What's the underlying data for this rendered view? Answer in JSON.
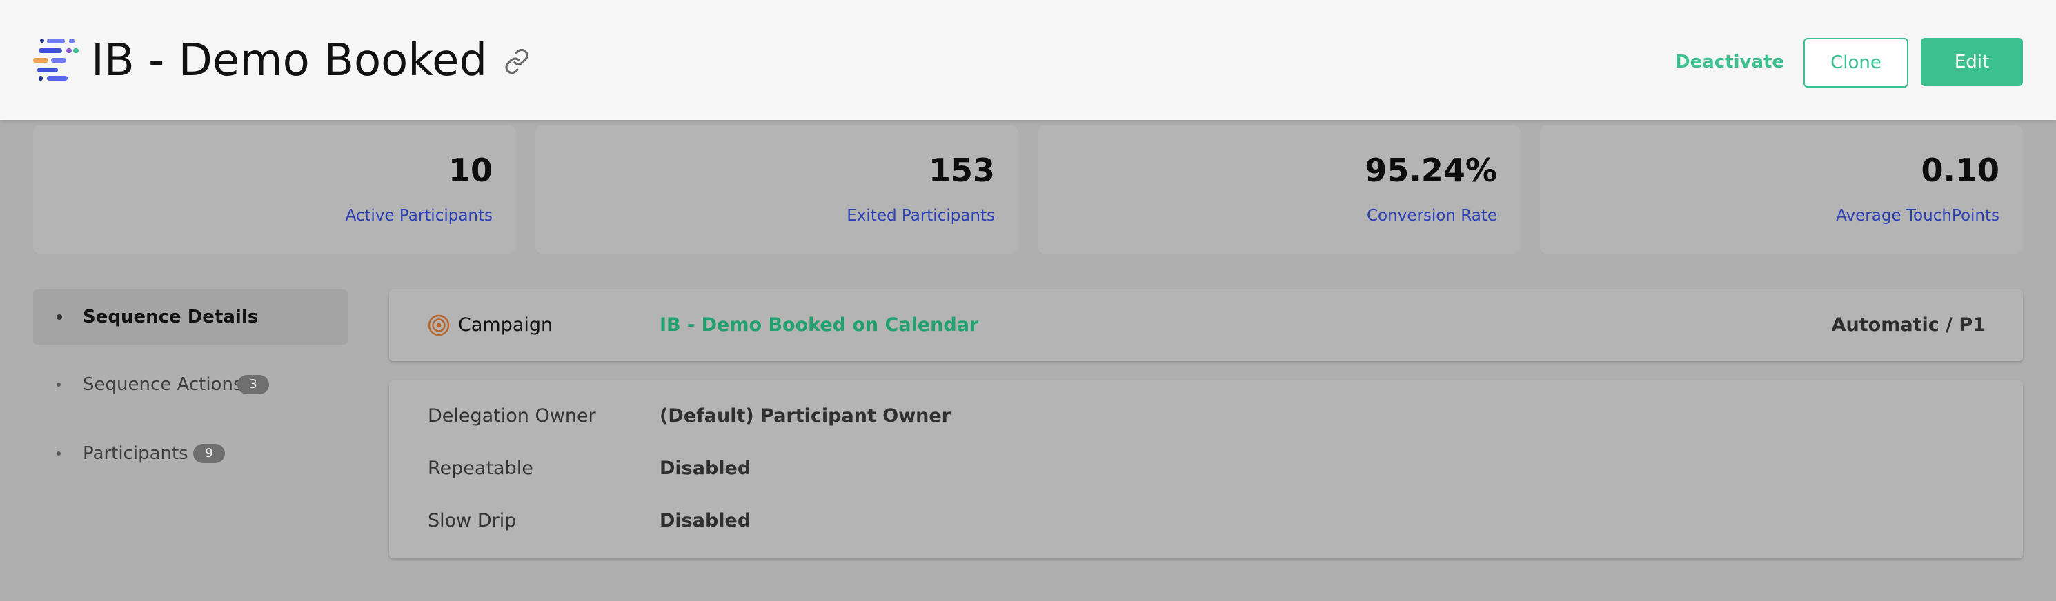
{
  "header": {
    "title": "IB - Demo Booked",
    "logo_icon": "sequence-logo-icon",
    "link_icon": "link-icon",
    "buttons": {
      "deactivate": "Deactivate",
      "clone": "Clone",
      "edit": "Edit"
    }
  },
  "stats": [
    {
      "value": "10",
      "label": "Active Participants"
    },
    {
      "value": "153",
      "label": "Exited Participants"
    },
    {
      "value": "95.24%",
      "label": "Conversion Rate"
    },
    {
      "value": "0.10",
      "label": "Average TouchPoints"
    }
  ],
  "sidebar": {
    "items": [
      {
        "label": "Sequence Details",
        "active": true
      },
      {
        "label": "Sequence Actions",
        "badge": "3"
      },
      {
        "label": "Participants",
        "badge": "9"
      }
    ]
  },
  "campaign": {
    "label": "Campaign",
    "name": "IB - Demo Booked on Calendar",
    "mode": "Automatic / P1",
    "icon": "target-icon"
  },
  "details": [
    {
      "key": "Delegation Owner",
      "value": "(Default) Participant Owner"
    },
    {
      "key": "Repeatable",
      "value": "Disabled"
    },
    {
      "key": "Slow Drip",
      "value": "Disabled"
    }
  ],
  "colors": {
    "accent": "#3cc08f",
    "link_blue": "#2a3fb6",
    "campaign_green": "#23a06f",
    "overlay_gray": "#afafaf"
  }
}
